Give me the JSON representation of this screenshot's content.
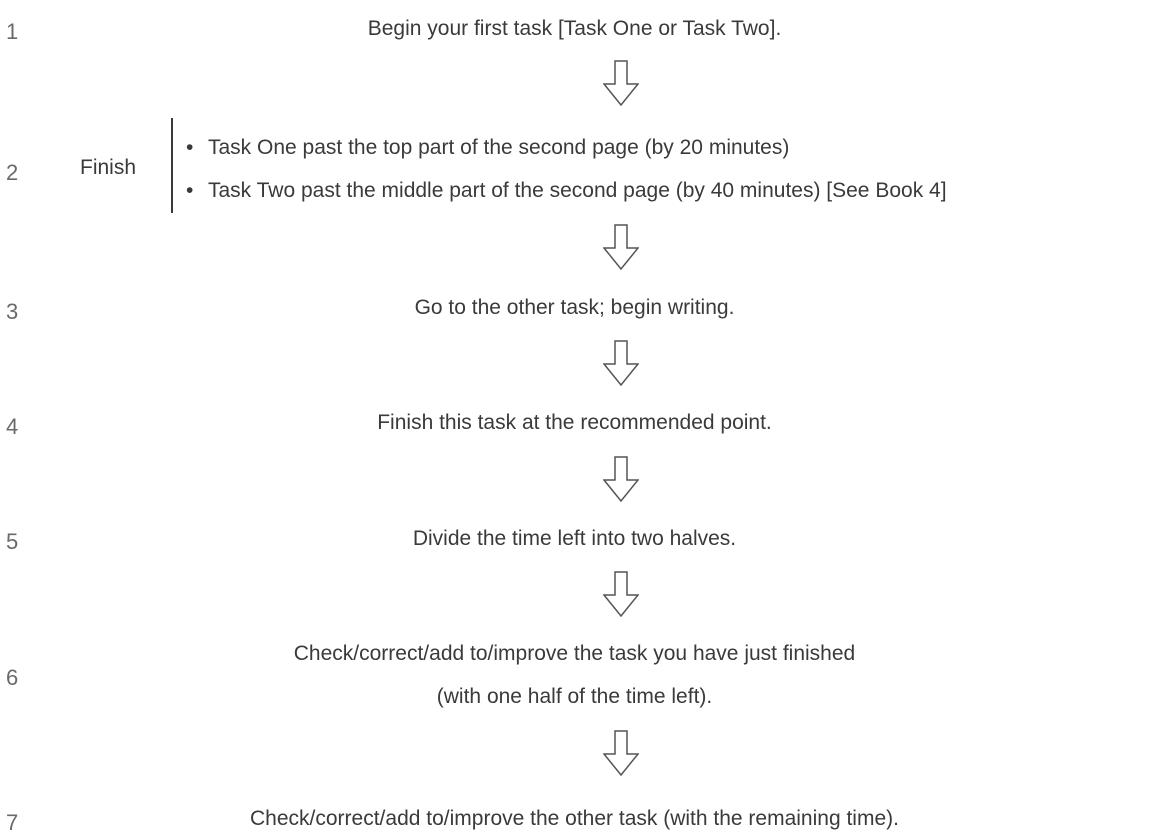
{
  "steps": [
    {
      "num": "1",
      "text": "Begin your first task [Task One or Task Two]."
    },
    {
      "num": "2",
      "label": "Finish",
      "bullets": [
        "Task One past the top part of the second page (by 20 minutes)",
        "Task Two past the middle part of the second page (by 40 minutes) [See Book 4]"
      ]
    },
    {
      "num": "3",
      "text": "Go to the other task; begin writing."
    },
    {
      "num": "4",
      "text": "Finish this task at the recommended point."
    },
    {
      "num": "5",
      "text": "Divide the time left into two halves."
    },
    {
      "num": "6",
      "line1": "Check/correct/add to/improve the task you have just finished",
      "line2": "(with one half of the time left)."
    },
    {
      "num": "7",
      "text": "Check/correct/add to/improve the other task (with the remaining time)."
    }
  ],
  "bullet_char": "•",
  "arrow_icon": "down-arrow-icon"
}
